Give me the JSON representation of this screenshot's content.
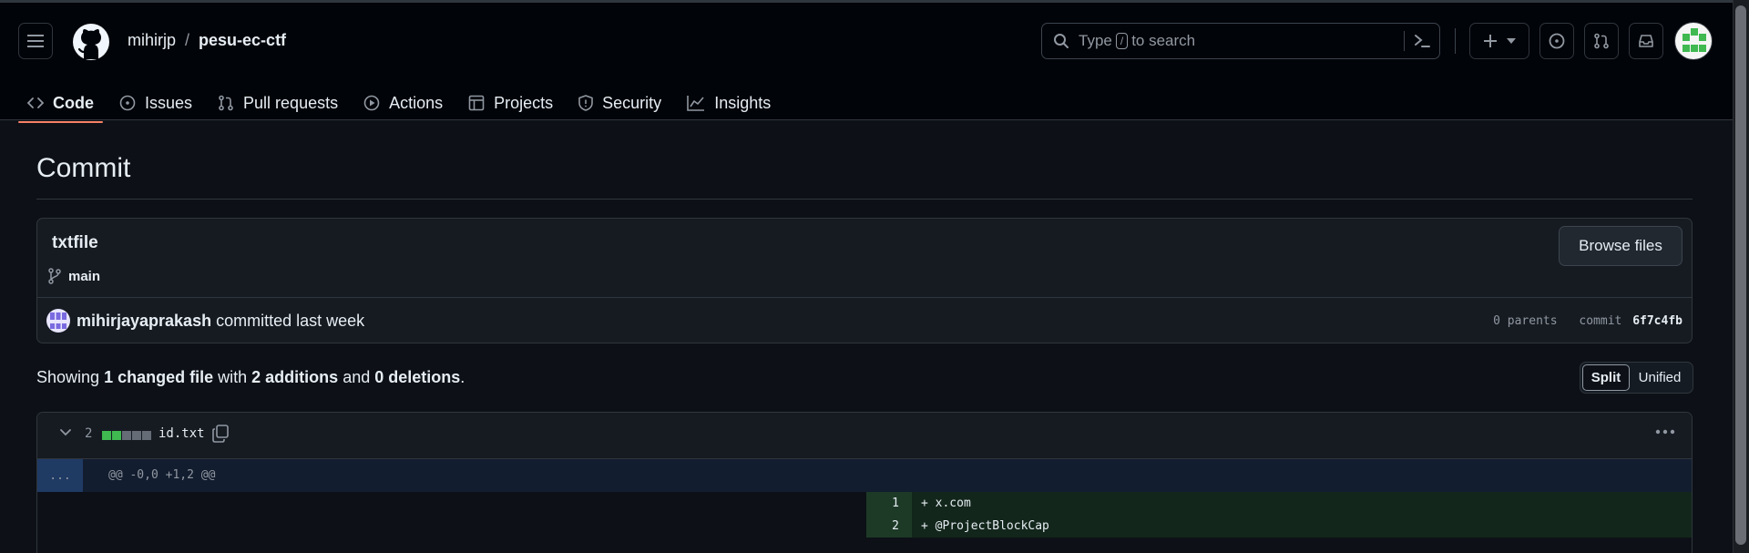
{
  "header": {
    "owner": "mihirjp",
    "separator": "/",
    "repo": "pesu-ec-ctf",
    "search_prefix": "Type",
    "search_key": "/",
    "search_suffix": "to search"
  },
  "tabs": [
    {
      "label": "Code",
      "icon": "code-icon",
      "active": true
    },
    {
      "label": "Issues",
      "icon": "issue-opened-icon"
    },
    {
      "label": "Pull requests",
      "icon": "git-pull-request-icon"
    },
    {
      "label": "Actions",
      "icon": "play-icon"
    },
    {
      "label": "Projects",
      "icon": "table-icon"
    },
    {
      "label": "Security",
      "icon": "shield-icon"
    },
    {
      "label": "Insights",
      "icon": "graph-icon"
    }
  ],
  "page": {
    "title": "Commit"
  },
  "commit": {
    "message": "txtfile",
    "branch": "main",
    "browse_label": "Browse files",
    "author": "mihirjayaprakash",
    "action_text": "committed last week",
    "parents_label": "0 parents",
    "commit_label": "commit",
    "sha": "6f7c4fb"
  },
  "summary": {
    "prefix": "Showing",
    "changed": "1 changed file",
    "with": "with",
    "additions": "2 additions",
    "and": "and",
    "deletions": "0 deletions",
    "end": "."
  },
  "view_toggle": {
    "split": "Split",
    "unified": "Unified",
    "selected": "Split"
  },
  "file": {
    "change_count": "2",
    "name": "id.txt",
    "hunk_expander": "...",
    "hunk_header": "@@ -0,0 +1,2 @@",
    "lines": [
      {
        "number": "1",
        "text": "+ x.com"
      },
      {
        "number": "2",
        "text": "+ @ProjectBlockCap"
      }
    ]
  },
  "colors": {
    "background": "#0d1117",
    "header": "#010409",
    "accent_underline": "#f78166",
    "addition_green": "#3fb950"
  }
}
